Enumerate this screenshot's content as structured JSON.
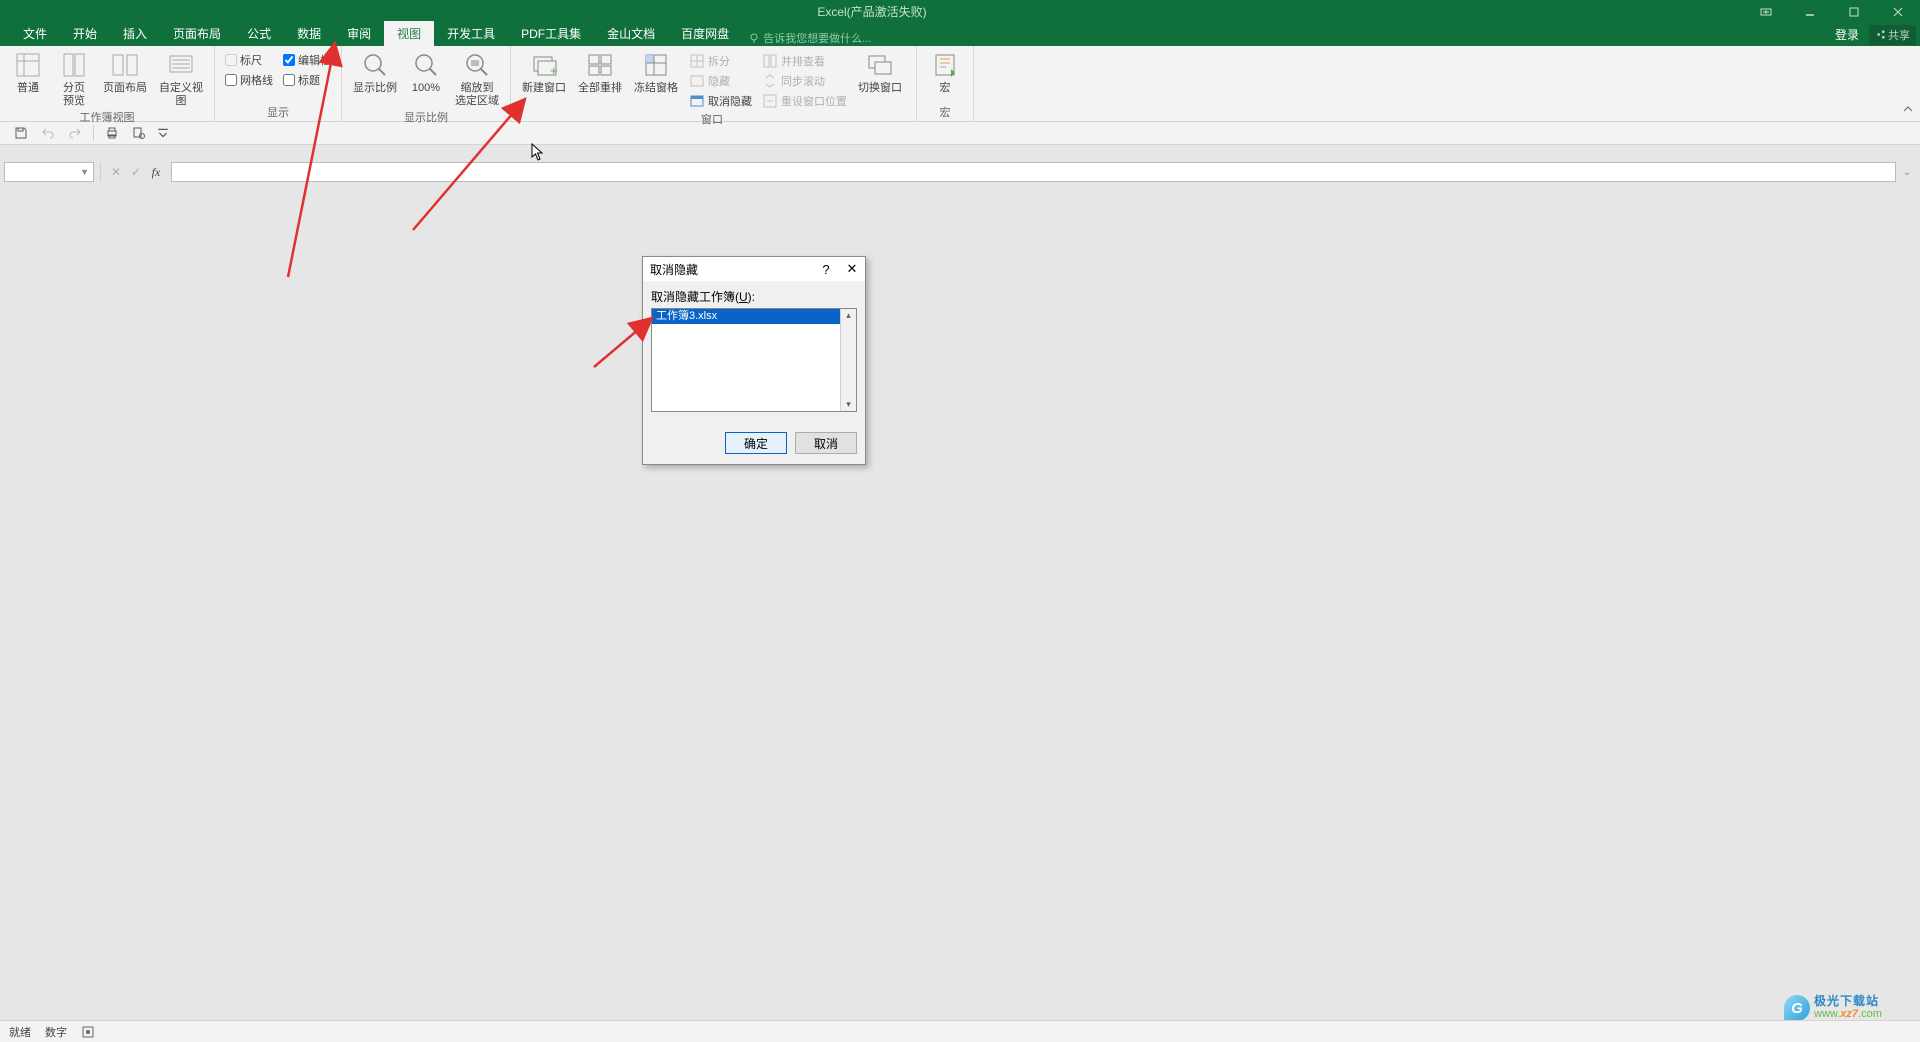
{
  "titlebar": {
    "title": "Excel(产品激活失败)"
  },
  "menu": {
    "items": [
      "文件",
      "开始",
      "插入",
      "页面布局",
      "公式",
      "数据",
      "审阅",
      "视图",
      "开发工具",
      "PDF工具集",
      "金山文档",
      "百度网盘"
    ],
    "active_index": 7,
    "tellme_placeholder": "告诉我您想要做什么...",
    "login": "登录",
    "share": "共享"
  },
  "ribbon": {
    "groups": {
      "view": {
        "label": "工作簿视图",
        "normal": "普通",
        "pagebreak": "分页\n预览",
        "pagelayout": "页面布局",
        "custom": "自定义视图"
      },
      "show": {
        "label": "显示",
        "ruler": "标尺",
        "formulabar": "编辑栏",
        "gridlines": "网格线",
        "headings": "标题"
      },
      "zoom": {
        "label": "显示比例",
        "zoom": "显示比例",
        "p100": "100%",
        "selection": "缩放到\n选定区域"
      },
      "window": {
        "label": "窗口",
        "new": "新建窗口",
        "arrange": "全部重排",
        "freeze": "冻结窗格",
        "split": "拆分",
        "hide": "隐藏",
        "unhide": "取消隐藏",
        "sidebyside": "并排查看",
        "syncscroll": "同步滚动",
        "resetpos": "重设窗口位置",
        "switch": "切换窗口"
      },
      "macros": {
        "label": "宏",
        "btn": "宏"
      }
    }
  },
  "formula": {
    "namebox": "",
    "fx": "fx"
  },
  "dialog": {
    "title": "取消隐藏",
    "label_pre": "取消隐藏工作簿(",
    "label_key": "U",
    "label_post": "):",
    "item": "工作簿3.xlsx",
    "ok": "确定",
    "cancel": "取消"
  },
  "status": {
    "ready": "就绪",
    "num": "数字"
  },
  "watermark": {
    "zh": "极光下载站",
    "url_pre": "www.",
    "url_mid": "xz7",
    "url_post": ".com"
  }
}
